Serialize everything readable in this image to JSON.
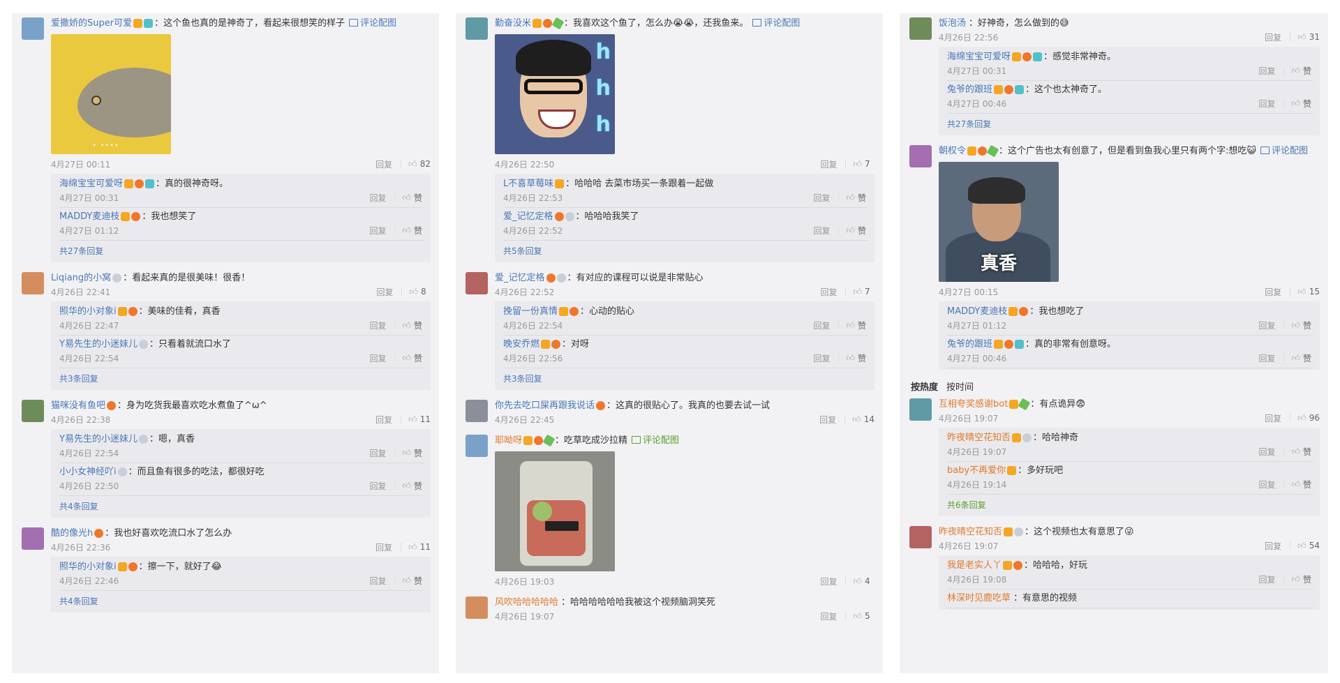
{
  "ui": {
    "reply": "回复",
    "like": "赞",
    "image_link": "评论配图"
  },
  "columns": [
    {
      "comments": [
        {
          "user": "爱撒娇的Super可爱",
          "user_color": "blue",
          "badges": [
            "vip",
            "cam"
          ],
          "text": "：这个鱼也真的是神奇了，看起来很想笑的样子",
          "image_link": true,
          "image": "fish",
          "image_h": 172,
          "time": "4月27日 00:11",
          "likes": "82",
          "replies": [
            {
              "user": "海绵宝宝可爱呀",
              "user_color": "blue",
              "badges": [
                "vip",
                "sun",
                "cam"
              ],
              "text": "：真的很神奇呀。",
              "time": "4月27日 00:31"
            },
            {
              "user": "MADDY麦迪枝",
              "user_color": "blue",
              "badges": [
                "vip",
                "sun"
              ],
              "text": "：我也想笑了",
              "time": "4月27日 01:12"
            }
          ],
          "more": "共27条回复"
        },
        {
          "user": "Liqiang的小窝",
          "user_color": "blue",
          "badges": [
            "dia"
          ],
          "text": "：看起来真的是很美味！很香！",
          "time": "4月26日 22:41",
          "likes": "8",
          "replies": [
            {
              "user": "照华的小对象i",
              "user_color": "blue",
              "badges": [
                "vip",
                "sun"
              ],
              "text": "：美味的佳肴，真香",
              "time": "4月26日 22:47"
            },
            {
              "user": "Y易先生的小迷妹儿",
              "user_color": "blue",
              "badges": [
                "dia"
              ],
              "text": "：只看着就流口水了",
              "time": "4月26日 22:54"
            }
          ],
          "more": "共3条回复"
        },
        {
          "user": "猫咪没有鱼吧",
          "user_color": "blue",
          "badges": [
            "sun"
          ],
          "text": "：身为吃货我最喜欢吃水煮鱼了^ω^",
          "time": "4月26日 22:38",
          "likes": "11",
          "replies": [
            {
              "user": "Y易先生的小迷妹儿",
              "user_color": "blue",
              "badges": [
                "dia"
              ],
              "text": "：嗯，真香",
              "time": "4月26日 22:54"
            },
            {
              "user": "小小女神经吖i",
              "user_color": "blue",
              "badges": [
                "dia"
              ],
              "text": "：而且鱼有很多的吃法，都很好吃",
              "time": "4月26日 22:50"
            }
          ],
          "more": "共4条回复"
        },
        {
          "user": "酷的像光h",
          "user_color": "blue",
          "badges": [
            "sun"
          ],
          "text": "：我也好喜欢吃流口水了怎么办",
          "time": "4月26日 22:36",
          "likes": "11",
          "replies": [
            {
              "user": "照华的小对象i",
              "user_color": "blue",
              "badges": [
                "vip",
                "sun"
              ],
              "text": "：擦一下，就好了😂",
              "time": "4月26日 22:46"
            }
          ],
          "more": "共4条回复"
        }
      ]
    },
    {
      "comments": [
        {
          "user": "勤奋没米",
          "user_color": "blue",
          "badges": [
            "vip",
            "sun",
            "tool"
          ],
          "text": "：我喜欢这个鱼了，怎么办😭😭，还我鱼来。",
          "image_link": true,
          "image": "man",
          "image_h": 172,
          "time": "4月26日 22:50",
          "likes": "7",
          "replies": [
            {
              "user": "L不喜草莓味",
              "user_color": "blue",
              "badges": [
                "vip"
              ],
              "text": "：哈哈哈  去菜市场买一条跟着一起做",
              "time": "4月26日 22:53"
            },
            {
              "user": "爱_记忆定格",
              "user_color": "blue",
              "badges": [
                "sun",
                "dia"
              ],
              "text": "：哈哈哈我笑了",
              "time": "4月26日 22:52"
            }
          ],
          "more": "共5条回复"
        },
        {
          "user": "爱_记忆定格",
          "user_color": "blue",
          "badges": [
            "sun",
            "dia"
          ],
          "text": "：有对应的课程可以说是非常贴心",
          "time": "4月26日 22:52",
          "likes": "7",
          "replies": [
            {
              "user": "挽留一份真情",
              "user_color": "blue",
              "badges": [
                "vip",
                "sun"
              ],
              "text": "：心动的贴心",
              "time": "4月26日 22:54"
            },
            {
              "user": "晚安乔燃",
              "user_color": "blue",
              "badges": [
                "vip",
                "sun"
              ],
              "text": "：对呀",
              "time": "4月26日 22:56"
            }
          ],
          "more": "共3条回复"
        },
        {
          "user": "你先去吃口屎再跟我说话",
          "user_color": "blue",
          "badges": [
            "sun"
          ],
          "text": "：这真的很贴心了。我真的也要去试一试",
          "time": "4月26日 22:45",
          "likes": "14",
          "replies": []
        },
        {
          "user": "耶呦呀",
          "user_color": "orange",
          "badges": [
            "vip",
            "sun",
            "tool"
          ],
          "text": "：吃草吃成沙拉精",
          "image_link": true,
          "image_link_green": true,
          "image": "salad",
          "image_h": 172,
          "time": "4月26日 19:03",
          "likes": "4",
          "replies": []
        },
        {
          "user": "风吹哈哈哈哈哈",
          "user_color": "orange",
          "badges": [],
          "text": "：哈哈哈哈哈哈我被这个视频脑洞笑死",
          "time": "4月26日 19:07",
          "likes": "5",
          "replies": []
        }
      ]
    },
    {
      "comments": [
        {
          "user": "饭泡汤",
          "user_color": "blue",
          "badges": [],
          "text": "：好神奇，怎么做到的😅",
          "time": "4月26日 22:56",
          "likes": "31",
          "replies": [
            {
              "user": "海绵宝宝可爱呀",
              "user_color": "blue",
              "badges": [
                "vip",
                "sun",
                "cam"
              ],
              "text": "：感觉非常神奇。",
              "time": "4月27日 00:31"
            },
            {
              "user": "兔爷的跟班",
              "user_color": "blue",
              "badges": [
                "vip",
                "sun",
                "cam"
              ],
              "text": "：这个也太神奇了。",
              "time": "4月27日 00:46"
            }
          ],
          "more": "共27条回复"
        },
        {
          "user": "朝权令",
          "user_color": "blue",
          "badges": [
            "vip",
            "sun",
            "tool"
          ],
          "text": "：这个广告也太有创意了，但是看到鱼我心里只有两个字:想吃😺",
          "image_link": true,
          "image": "xiang",
          "image_text": "真香",
          "image_h": 172,
          "time": "4月27日 00:15",
          "likes": "15",
          "replies": [
            {
              "user": "MADDY麦迪枝",
              "user_color": "blue",
              "badges": [
                "vip",
                "sun"
              ],
              "text": "：我也想吃了",
              "time": "4月27日 01:12"
            },
            {
              "user": "兔爷的跟班",
              "user_color": "blue",
              "badges": [
                "vip",
                "sun",
                "cam"
              ],
              "text": "：真的非常有创意呀。",
              "time": "4月27日 00:46"
            }
          ]
        },
        {
          "sorttabs": [
            "按热度",
            "按时间"
          ]
        },
        {
          "user": "互相夸奖感谢bot",
          "user_color": "orange",
          "badges": [
            "vip",
            "tool"
          ],
          "text": "：有点诡异😨",
          "time": "4月26日 19:07",
          "likes": "96",
          "replies": [
            {
              "user": "昨夜晴空花知否",
              "user_color": "orange",
              "badges": [
                "vip",
                "dia"
              ],
              "text": "：哈哈神奇",
              "time": "4月26日 19:07"
            },
            {
              "user": "baby不再爱你",
              "user_color": "orange",
              "badges": [
                "vip"
              ],
              "text": "：多好玩吧",
              "time": "4月26日 19:14"
            }
          ],
          "more": "共6条回复",
          "more_green": true
        },
        {
          "user": "昨夜晴空花知否",
          "user_color": "orange",
          "badges": [
            "vip",
            "dia"
          ],
          "text": "：这个视频也太有意思了😜",
          "time": "4月26日 19:07",
          "likes": "54",
          "replies": [
            {
              "user": "我是老实人丫",
              "user_color": "orange",
              "badges": [
                "vip",
                "sun"
              ],
              "text": "：哈哈哈，好玩",
              "time": "4月26日 19:08"
            },
            {
              "user": "林深时见鹿吃草",
              "user_color": "orange",
              "badges": [],
              "text": "：有意思的视频",
              "time": ""
            }
          ]
        }
      ]
    }
  ]
}
